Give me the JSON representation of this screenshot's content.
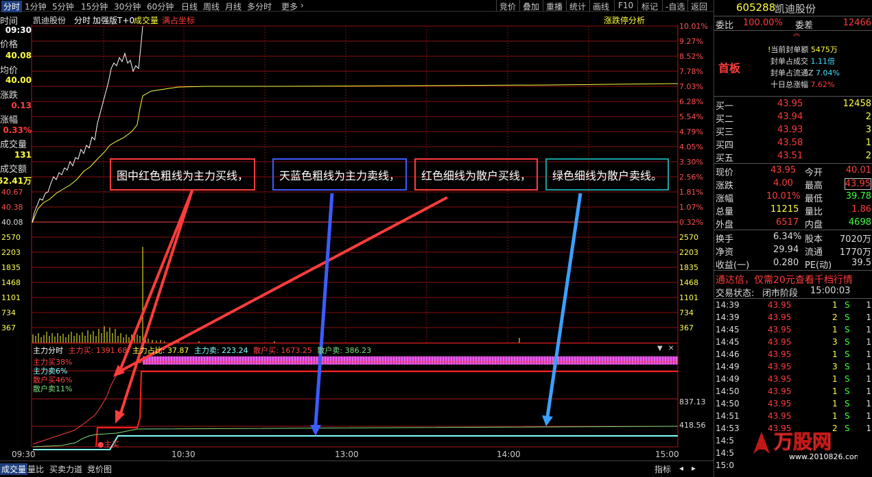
{
  "toolbar": {
    "tabs": [
      "分时",
      "1分钟",
      "5分钟",
      "15分钟",
      "30分钟",
      "60分钟",
      "日线",
      "周线",
      "月线",
      "多分时",
      "更多"
    ],
    "more_chevron": "›",
    "right_items": [
      "竞价",
      "叠加",
      "重播",
      "统计",
      "画线",
      "F10",
      "标记",
      "-自选",
      "返回"
    ]
  },
  "chart_header": {
    "name": "凯迪股份",
    "mode": "分时",
    "version": "加强版T+0",
    "indicator": "成交量",
    "overlay": "满占坐标",
    "right_link": "涨跌停分析"
  },
  "left_info": [
    {
      "label": "时间",
      "value": "09:30",
      "color": "white"
    },
    {
      "label": "价格",
      "value": "40.08",
      "color": "yellow"
    },
    {
      "label": "均价",
      "value": "40.00",
      "color": "yellow"
    },
    {
      "label": "涨跌",
      "value": "0.13",
      "color": "red"
    },
    {
      "label": "涨幅",
      "value": "0.33%",
      "color": "red"
    },
    {
      "label": "成交量",
      "value": "131",
      "color": "yellow"
    },
    {
      "label": "成交额",
      "value": "52.41万",
      "color": "yellow"
    }
  ],
  "price_axis_left": [
    "40.67",
    "40.38",
    "40.08"
  ],
  "price_axis_right": [
    "10.01%",
    "9.27%",
    "8.52%",
    "7.78%",
    "7.03%",
    "6.28%",
    "5.54%",
    "4.79%",
    "4.05%",
    "3.30%",
    "2.56%",
    "1.81%",
    "1.07%",
    "0.32%"
  ],
  "volume_axis": [
    "2570",
    "2203",
    "1835",
    "1468",
    "1101",
    "734",
    "367"
  ],
  "indicator_panel": {
    "header": {
      "title": "主力分时",
      "items": [
        {
          "label": "主力买:",
          "value": "1391.68",
          "color": "red"
        },
        {
          "label": "主力占比:",
          "value": "37.87",
          "color": "yellow"
        },
        {
          "label": "主力卖:",
          "value": "223.24",
          "color": "cyan"
        },
        {
          "label": "散户买:",
          "value": "1673.25",
          "color": "red"
        },
        {
          "label": "散户卖:",
          "value": "386.23",
          "color": "green"
        }
      ]
    },
    "legend": [
      {
        "text": "主力买38%",
        "color": "red"
      },
      {
        "text": "主力卖6%",
        "color": "cyan"
      },
      {
        "text": "散户买46%",
        "color": "red"
      },
      {
        "text": "散户卖11%",
        "color": "green"
      }
    ],
    "axis": [
      "837.13",
      "418.56"
    ],
    "marker": "主买",
    "buttons": [
      "▼",
      "✕"
    ]
  },
  "time_axis": [
    "09:30",
    "10:30",
    "13:00",
    "14:00",
    "15:00"
  ],
  "callouts": [
    {
      "text": "图中红色粗线为主力买线，",
      "border": "#ff3c3c"
    },
    {
      "text": "天蓝色粗线为主力卖线，",
      "border": "#3c5cff"
    },
    {
      "text": "红色细线为散户买线，",
      "border": "#ff3c3c"
    },
    {
      "text": "绿色细线为散户卖线。",
      "border": "#1aa0a0"
    }
  ],
  "bottom_tabs": [
    "成交量",
    "量比",
    "买卖力道",
    "竞价图"
  ],
  "bottom_right": "指标",
  "right_panel": {
    "code": "605288",
    "name": "凯迪股份",
    "weibi_label": "委比",
    "weibi": "100.00%",
    "weicha_label": "委差",
    "weicha": "12466",
    "tag": "首板",
    "seal_info": [
      {
        "label": "当前封单额",
        "value": "5475万"
      },
      {
        "label": "封单占成交",
        "value": "1.11倍"
      },
      {
        "label": "封单占流通Z",
        "value": "7.04%"
      },
      {
        "label": "十日总涨幅",
        "value": "7.62%"
      }
    ],
    "buy_levels": [
      {
        "label": "买一",
        "price": "43.95",
        "vol": "12458"
      },
      {
        "label": "买二",
        "price": "43.94",
        "vol": "2"
      },
      {
        "label": "买三",
        "price": "43.93",
        "vol": "3"
      },
      {
        "label": "买四",
        "price": "43.58",
        "vol": "1"
      },
      {
        "label": "买五",
        "price": "43.51",
        "vol": "2"
      }
    ],
    "quote": [
      {
        "l1": "现价",
        "v1": "43.95",
        "c1": "red",
        "l2": "今开",
        "v2": "40.01",
        "c2": "red"
      },
      {
        "l1": "涨跌",
        "v1": "4.00",
        "c1": "red",
        "l2": "最高",
        "v2": "43.95",
        "c2": "red"
      },
      {
        "l1": "涨幅",
        "v1": "10.01%",
        "c1": "red",
        "l2": "最低",
        "v2": "39.78",
        "c2": "green"
      },
      {
        "l1": "总量",
        "v1": "11215",
        "c1": "yellow",
        "l2": "量比",
        "v2": "1.86",
        "c2": "red"
      },
      {
        "l1": "外盘",
        "v1": "6517",
        "c1": "red",
        "l2": "内盘",
        "v2": "4698",
        "c2": "green"
      }
    ],
    "stats": [
      {
        "l1": "换手",
        "v1": "6.34%",
        "l2": "股本",
        "v2": "7020万"
      },
      {
        "l1": "净资",
        "v1": "29.94",
        "l2": "流通",
        "v2": "1770万"
      },
      {
        "l1": "收益(一)",
        "v1": "0.280",
        "l2": "PE(动)",
        "v2": "39.5"
      }
    ],
    "ad_text": "通达信，仅需20元查看千档行情",
    "status_label": "交易状态:",
    "status_value": "闭市阶段",
    "status_time": "15:00:03",
    "ticks": [
      {
        "time": "14:39",
        "price": "43.95",
        "vol": "1",
        "side": "S",
        "n": "1"
      },
      {
        "time": "14:39",
        "price": "43.95",
        "vol": "2",
        "side": "S",
        "n": "1"
      },
      {
        "time": "14:45",
        "price": "43.95",
        "vol": "1",
        "side": "S",
        "n": "1"
      },
      {
        "time": "14:45",
        "price": "43.95",
        "vol": "3",
        "side": "S",
        "n": "1"
      },
      {
        "time": "14:46",
        "price": "43.95",
        "vol": "1",
        "side": "S",
        "n": "1"
      },
      {
        "time": "14:49",
        "price": "43.95",
        "vol": "3",
        "side": "S",
        "n": "1"
      },
      {
        "time": "14:49",
        "price": "43.95",
        "vol": "1",
        "side": "S",
        "n": "1"
      },
      {
        "time": "14:50",
        "price": "43.95",
        "vol": "1",
        "side": "S",
        "n": "1"
      },
      {
        "time": "14:50",
        "price": "43.95",
        "vol": "1",
        "side": "S",
        "n": "1"
      },
      {
        "time": "14:51",
        "price": "43.95",
        "vol": "1",
        "side": "S",
        "n": "1"
      },
      {
        "time": "14:53",
        "price": "43.95",
        "vol": "2",
        "side": "S",
        "n": "1"
      },
      {
        "time": "14:5",
        "price": "",
        "vol": "",
        "side": "",
        "n": ""
      },
      {
        "time": "14:5",
        "price": "",
        "vol": "",
        "side": "",
        "n": ""
      },
      {
        "time": "15:0",
        "price": "",
        "vol": "",
        "side": "",
        "n": ""
      }
    ]
  },
  "logo": {
    "text": "万股网",
    "url": "www.2010826.com"
  }
}
